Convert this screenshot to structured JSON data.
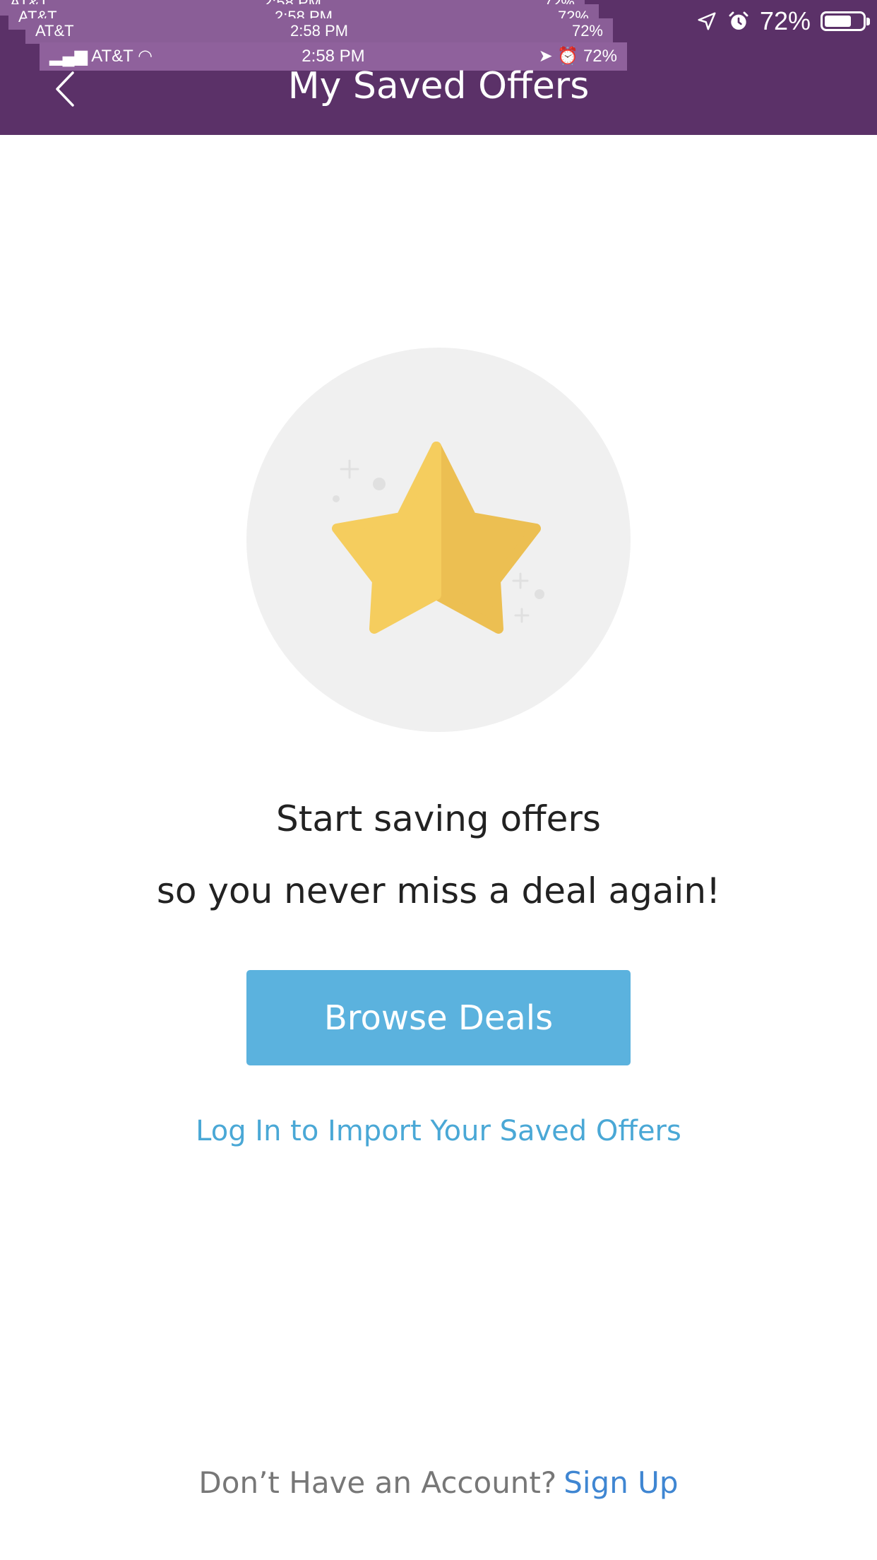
{
  "status_bar": {
    "carrier": "AT&T",
    "time": "2:58 PM",
    "battery": "72%",
    "battery_level": 0.72
  },
  "header": {
    "title": "My Saved Offers",
    "back_icon": "chevron-left-icon"
  },
  "hero": {
    "icon": "star-icon"
  },
  "message": {
    "line1": "Start saving offers",
    "line2": "so you never miss a deal again!"
  },
  "actions": {
    "browse_label": "Browse Deals",
    "login_link": "Log In to Import Your Saved Offers"
  },
  "footer": {
    "prompt": "Don’t Have an Account?",
    "signup_link": "Sign Up"
  },
  "colors": {
    "header_bg": "#5b3168",
    "button_bg": "#5bb2de",
    "link": "#4aa8d6",
    "signup_link": "#3f86d2",
    "star_light": "#f5cd5e",
    "star_dark": "#ecbf52"
  }
}
